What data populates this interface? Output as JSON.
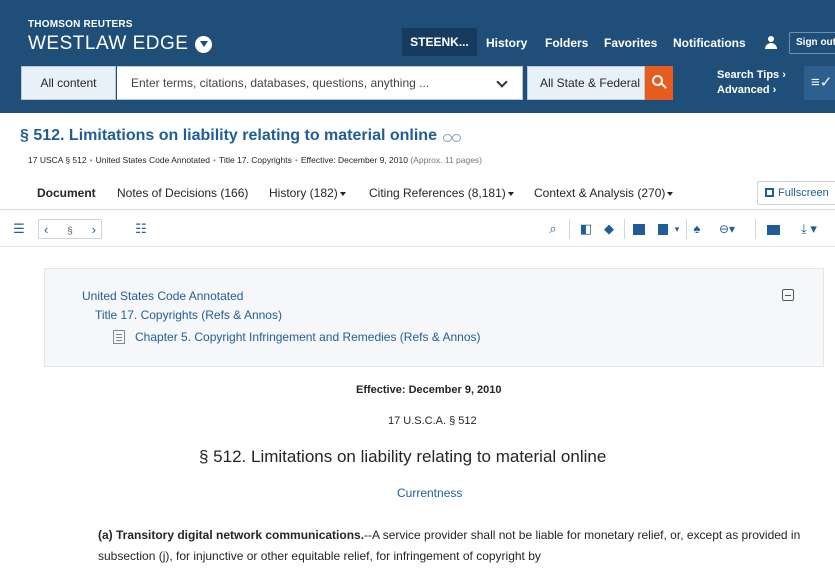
{
  "header": {
    "brand_small": "THOMSON REUTERS",
    "brand_big": "WESTLAW EDGE",
    "nav": {
      "client": "STEENK...",
      "history": "History",
      "folders": "Folders",
      "favorites": "Favorites",
      "notifications": "Notifications",
      "sign_out": "Sign out"
    },
    "search": {
      "content_select": "All content",
      "placeholder": "Enter terms, citations, databases, questions, anything ...",
      "jurisdiction": "All State & Federal",
      "tips_line1": "Search Tips",
      "tips_line2": "Advanced"
    }
  },
  "document": {
    "title": "§ 512. Limitations on liability relating to material online",
    "meta": {
      "cite": "17 USCA § 512",
      "source": "United States Code Annotated",
      "title17": "Title 17. Copyrights",
      "effective": "Effective: December 9, 2010",
      "pages": "(Approx. 11 pages)"
    },
    "tabs": {
      "document": "Document",
      "notes": "Notes of Decisions (166)",
      "history": "History (182)",
      "citing": "Citing References (8,181)",
      "context": "Context & Analysis (270)"
    },
    "fullscreen": "Fullscreen",
    "toolbar": {
      "section_symbol": "§"
    },
    "breadcrumb": {
      "level1": "United States Code Annotated",
      "level2": "Title 17. Copyrights (Refs & Annos)",
      "level3": "Chapter 5. Copyright Infringement and Remedies (Refs & Annos)"
    },
    "body": {
      "effective": "Effective: December 9, 2010",
      "cite": "17 U.S.C.A. § 512",
      "title": "§ 512. Limitations on liability relating to material online",
      "currentness": "Currentness",
      "para_heading": "(a) Transitory digital network communications.",
      "para_text": "--A service provider shall not be liable for monetary relief, or, except as provided in subsection (j), for injunctive or other equitable relief, for infringement of copyright by"
    }
  },
  "colors": {
    "header_bg": "#1f4e79",
    "link": "#1f5d99",
    "search_button": "#e75c1c"
  }
}
